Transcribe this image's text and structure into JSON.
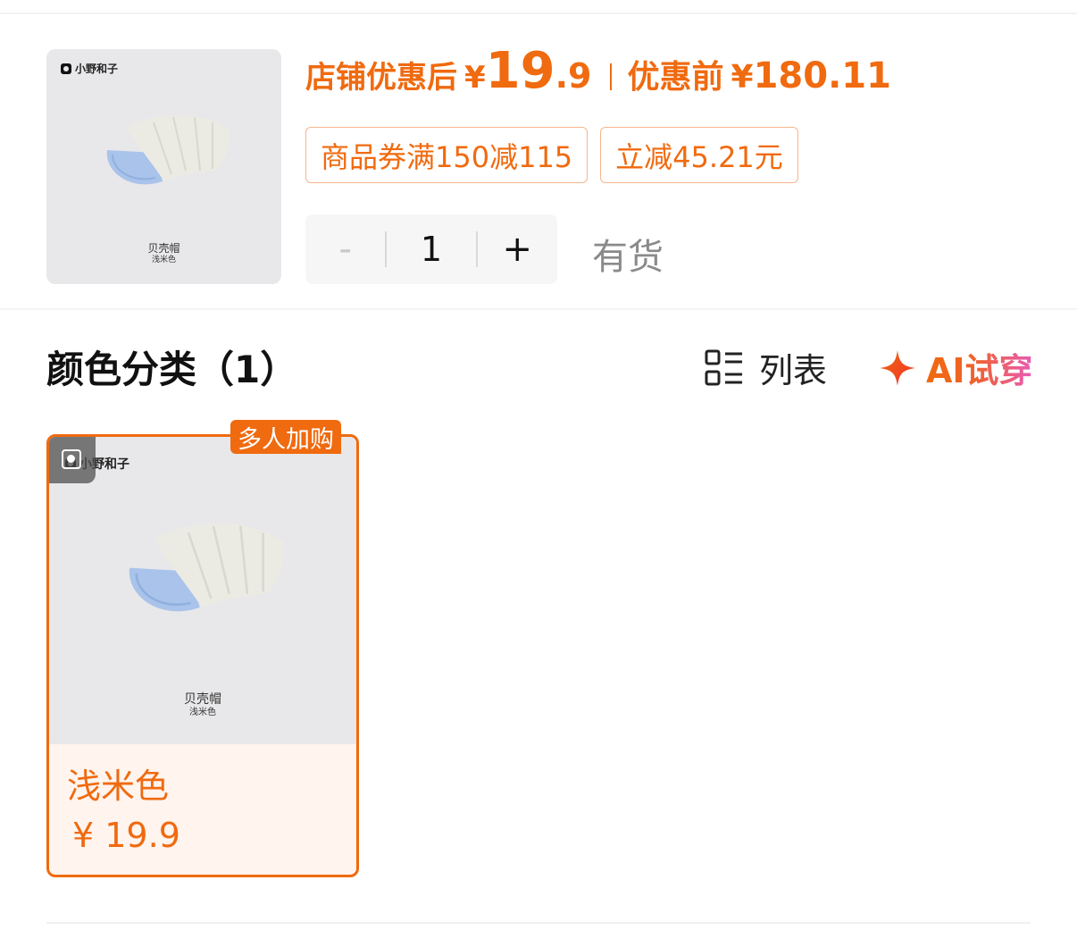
{
  "product": {
    "brand": "小野和子",
    "image_title": "贝壳帽",
    "image_color": "浅米色",
    "price_after_label": "店铺优惠后",
    "currency": "¥",
    "price_after_int": "19",
    "price_after_dec": ".9",
    "price_before_label": "优惠前",
    "price_before": "180.11",
    "coupons": [
      "商品券满150减115",
      "立减45.21元"
    ],
    "quantity": "1",
    "minus_label": "-",
    "plus_label": "+",
    "stock_status": "有货"
  },
  "category": {
    "title": "颜色分类（1）",
    "view_label": "列表",
    "ai_label": "AI试穿",
    "icons": {
      "view": "list-grid-icon",
      "ai": "sparkle-icon"
    }
  },
  "variants": [
    {
      "badge": "多人加购",
      "name": "浅米色",
      "price": "¥ 19.9",
      "brand": "小野和子",
      "image_title": "贝壳帽",
      "image_color": "浅米色"
    }
  ],
  "colors": {
    "accent": "#f06a0f",
    "tag_border": "#f7b58a",
    "card_bg": "#fff4ee",
    "image_bg": "#e8e8ea",
    "cap_outer": "#ecebe3",
    "cap_inner": "#a9c3ea"
  }
}
